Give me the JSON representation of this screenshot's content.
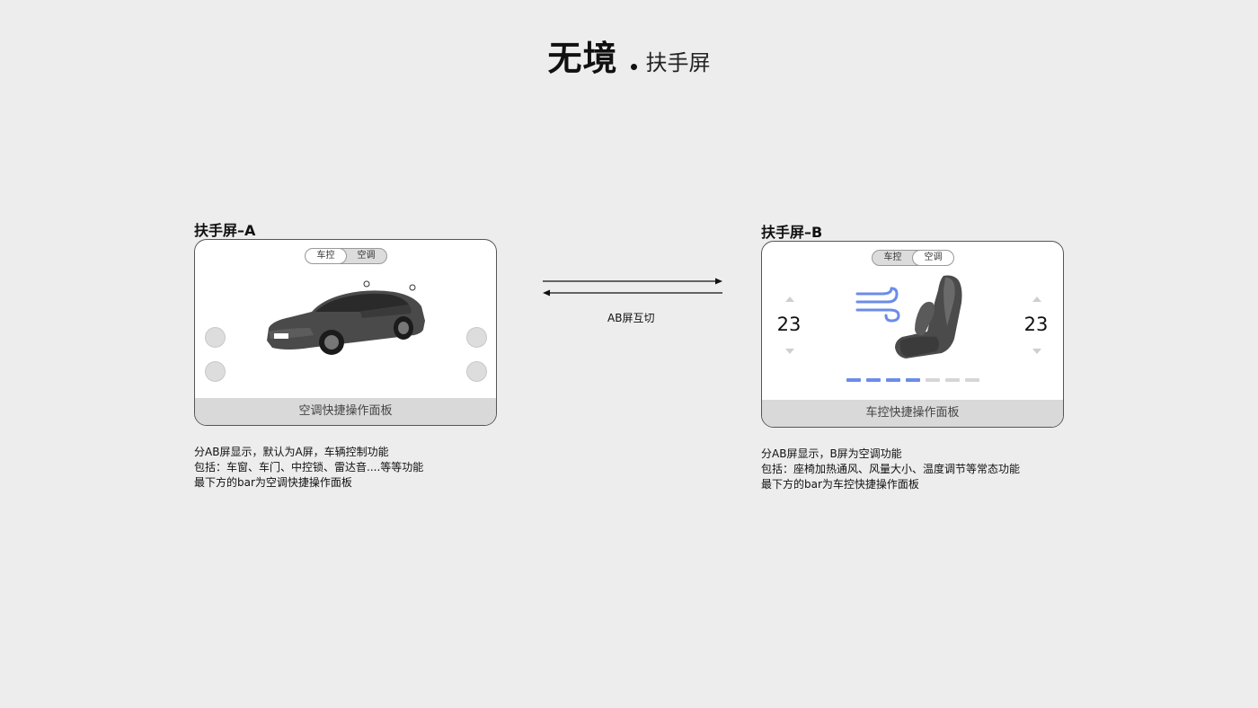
{
  "header": {
    "title": "无境",
    "subtitle": "扶手屏"
  },
  "panel_a": {
    "title": "扶手屏–A",
    "tabs": [
      "车控",
      "空调"
    ],
    "active_tab": 0,
    "bottom_bar": "空调快捷操作面板",
    "description": [
      "分AB屏显示，默认为A屏，车辆控制功能",
      "包括：车窗、车门、中控锁、雷达音....等等功能",
      "最下方的bar为空调快捷操作面板"
    ]
  },
  "switch": {
    "label": "AB屏互切"
  },
  "panel_b": {
    "title": "扶手屏–B",
    "tabs": [
      "车控",
      "空调"
    ],
    "active_tab": 1,
    "temp_left": "23",
    "temp_right": "23",
    "fan_level": 4,
    "fan_max": 7,
    "accent_color": "#6b8ce8",
    "bottom_bar": "车控快捷操作面板",
    "description": [
      "分AB屏显示，B屏为空调功能",
      "包括：座椅加热通风、风量大小、温度调节等常态功能",
      "最下方的bar为车控快捷操作面板"
    ]
  }
}
